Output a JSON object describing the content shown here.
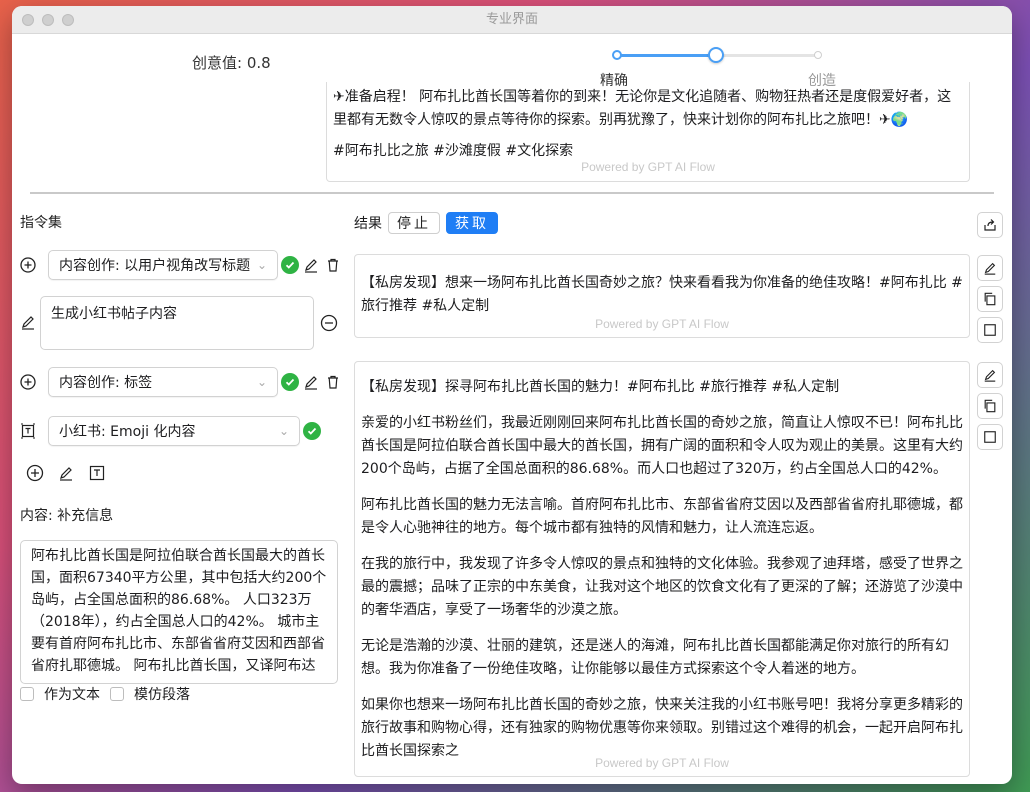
{
  "window": {
    "title": "专业界面"
  },
  "creativity": {
    "label": "创意值: 0.8",
    "value": 0.8
  },
  "slider": {
    "left_label": "精确",
    "right_label": "创造"
  },
  "top_output": {
    "paragraphs": [
      "✈准备启程！ 阿布扎比酋长国等着你的到来！无论你是文化追随者、购物狂热者还是度假爱好者，这里都有无数令人惊叹的景点等待你的探索。别再犹豫了，快来计划你的阿布扎比之旅吧！✈🌍",
      "#阿布扎比之旅 #沙滩度假 #文化探索"
    ],
    "powered": "Powered by GPT AI Flow"
  },
  "left": {
    "instruction_set_label": "指令集",
    "steps": [
      {
        "select": "内容创作: 以用户视角改写标题"
      },
      {
        "textarea": "生成小红书帖子内容"
      },
      {
        "select": "内容创作: 标签"
      },
      {
        "select": "小红书: Emoji 化内容"
      }
    ],
    "content_label": "内容: 补充信息",
    "content_text": "阿布扎比酋长国是阿拉伯联合酋长国最大的酋长国，面积67340平方公里，其中包括大约200个岛屿，占全国总面积的86.68%。 人口323万（2018年），约占全国总人口的42%。 城市主要有首府阿布扎比市、东部省省府艾因和西部省省府扎耶德城。 阿布扎比酋长国，又译阿布达",
    "checkbox_text": "作为文本",
    "checkbox_paragraph": "模仿段落"
  },
  "right": {
    "result_label": "结果",
    "stop_button": "停止",
    "fetch_button": "获取",
    "output1": {
      "text": "【私房发现】想来一场阿布扎比酋长国奇妙之旅？快来看看我为你准备的绝佳攻略！#阿布扎比 #旅行推荐 #私人定制",
      "powered": "Powered by GPT AI Flow"
    },
    "output2": {
      "paragraphs": [
        "【私房发现】探寻阿布扎比酋长国的魅力！#阿布扎比 #旅行推荐 #私人定制",
        "亲爱的小红书粉丝们，我最近刚刚回来阿布扎比酋长国的奇妙之旅，简直让人惊叹不已！阿布扎比酋长国是阿拉伯联合酋长国中最大的酋长国，拥有广阔的面积和令人叹为观止的美景。这里有大约200个岛屿，占据了全国总面积的86.68%。而人口也超过了320万，约占全国总人口的42%。",
        "阿布扎比酋长国的魅力无法言喻。首府阿布扎比市、东部省省府艾因以及西部省省府扎耶德城，都是令人心驰神往的地方。每个城市都有独特的风情和魅力，让人流连忘返。",
        "在我的旅行中，我发现了许多令人惊叹的景点和独特的文化体验。我参观了迪拜塔，感受了世界之最的震撼；品味了正宗的中东美食，让我对这个地区的饮食文化有了更深的了解；还游览了沙漠中的奢华酒店，享受了一场奢华的沙漠之旅。",
        "无论是浩瀚的沙漠、壮丽的建筑，还是迷人的海滩，阿布扎比酋长国都能满足你对旅行的所有幻想。我为你准备了一份绝佳攻略，让你能够以最佳方式探索这个令人着迷的地方。",
        "如果你也想来一场阿布扎比酋长国的奇妙之旅，快来关注我的小红书账号吧！我将分享更多精彩的旅行故事和购物心得，还有独家的购物优惠等你来领取。别错过这个难得的机会，一起开启阿布扎比酋长国探索之"
      ],
      "powered": "Powered by GPT AI Flow"
    }
  },
  "colors": {
    "accent": "#1f7ef5",
    "check": "#2fb344",
    "slider": "#4a9ff5"
  }
}
